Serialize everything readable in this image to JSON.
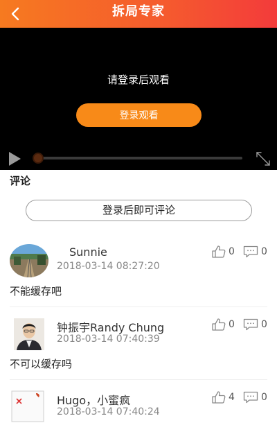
{
  "header": {
    "title": "拆局专家"
  },
  "player": {
    "message": "请登录后观看",
    "login_button": "登录观看",
    "progress": 0.02,
    "accent": "#f88a18"
  },
  "comments_section": {
    "heading": "评论",
    "login_prompt": "登录后即可评论",
    "items": [
      {
        "name": "Sunnie",
        "time": "2018-03-14 08:27:20",
        "text": "不能缓存吧",
        "likes": "0",
        "replies": "0"
      },
      {
        "name": "钟振宇Randy Chung",
        "time": "2018-03-14 07:40:39",
        "text": "不可以缓存吗",
        "likes": "0",
        "replies": "0"
      },
      {
        "name": "Hugo，小蜜疯",
        "time": "2018-03-14 07:40:24",
        "text": "",
        "likes": "4",
        "replies": "0"
      }
    ]
  },
  "icons": {
    "back": "chevron-left-icon",
    "play": "play-icon",
    "fullscreen": "fullscreen-icon",
    "like": "thumbs-up-icon",
    "reply": "comment-bubble-icon"
  }
}
